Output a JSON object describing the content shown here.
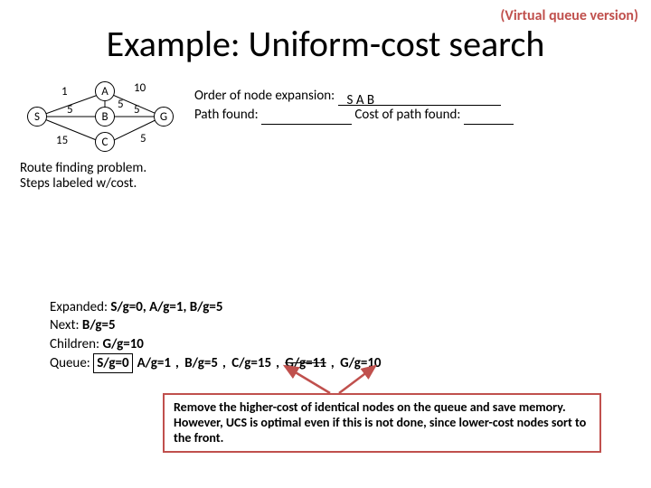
{
  "header": {
    "subtitle": "(Virtual queue version)",
    "title": "Example: Uniform-cost search"
  },
  "graph": {
    "nodes": {
      "S": "S",
      "A": "A",
      "B": "B",
      "C": "C",
      "G": "G"
    },
    "edges": {
      "SA": "1",
      "SB": "5",
      "SC": "15",
      "AB": "5",
      "AG": "10",
      "BG": "5",
      "CG": "5"
    }
  },
  "caption": {
    "line1": "Route finding problem.",
    "line2": "Steps labeled w/cost."
  },
  "questions": {
    "q1_label": "Order of node expansion:",
    "q1_answer": "S A B",
    "q2_label": "Path found:",
    "q3_label": "Cost of path found:"
  },
  "trace": {
    "expanded_label": "Expanded:",
    "expanded_val": "S/g=0, A/g=1, B/g=5",
    "next_label": "Next:",
    "next_val": "B/g=5",
    "children_label": "Children:",
    "children_val": "G/g=10",
    "queue_label": "Queue:",
    "queue": [
      {
        "text": "S/g=0",
        "boxed": true,
        "struck": false
      },
      {
        "text": "A/g=1",
        "boxed": false,
        "struck": false,
        "comma": ","
      },
      {
        "text": "B/g=5",
        "boxed": false,
        "struck": false,
        "comma": ","
      },
      {
        "text": "C/g=15",
        "boxed": false,
        "struck": false,
        "comma": ","
      },
      {
        "text": "G/g=11",
        "boxed": false,
        "struck": true,
        "comma": ","
      },
      {
        "text": "G/g=10",
        "boxed": false,
        "struck": false
      }
    ]
  },
  "note": "Remove the higher-cost of identical nodes on the queue and save memory. However, UCS is optimal even if this is not done, since lower-cost nodes sort to the front."
}
